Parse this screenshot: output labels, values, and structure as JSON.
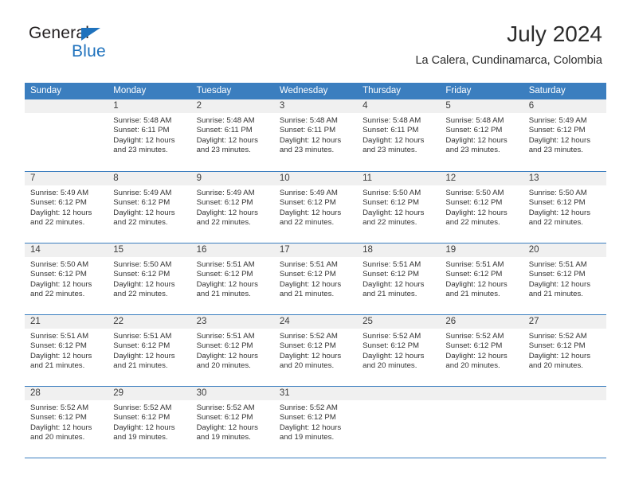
{
  "brand": {
    "name_primary": "General",
    "name_secondary": "Blue",
    "triangle_icon": "triangle-icon",
    "accent_color": "#1f72bd"
  },
  "header": {
    "title": "July 2024",
    "subtitle": "La Calera, Cundinamarca, Colombia"
  },
  "calendar": {
    "header_bg": "#3b7ebf",
    "daynum_bg": "#f0f0f0",
    "weekdays": [
      "Sunday",
      "Monday",
      "Tuesday",
      "Wednesday",
      "Thursday",
      "Friday",
      "Saturday"
    ],
    "weeks": [
      [
        {
          "day": "",
          "empty": true,
          "sunrise": "",
          "sunset": "",
          "daylight1": "",
          "daylight2": ""
        },
        {
          "day": "1",
          "empty": false,
          "sunrise": "Sunrise: 5:48 AM",
          "sunset": "Sunset: 6:11 PM",
          "daylight1": "Daylight: 12 hours",
          "daylight2": "and 23 minutes."
        },
        {
          "day": "2",
          "empty": false,
          "sunrise": "Sunrise: 5:48 AM",
          "sunset": "Sunset: 6:11 PM",
          "daylight1": "Daylight: 12 hours",
          "daylight2": "and 23 minutes."
        },
        {
          "day": "3",
          "empty": false,
          "sunrise": "Sunrise: 5:48 AM",
          "sunset": "Sunset: 6:11 PM",
          "daylight1": "Daylight: 12 hours",
          "daylight2": "and 23 minutes."
        },
        {
          "day": "4",
          "empty": false,
          "sunrise": "Sunrise: 5:48 AM",
          "sunset": "Sunset: 6:11 PM",
          "daylight1": "Daylight: 12 hours",
          "daylight2": "and 23 minutes."
        },
        {
          "day": "5",
          "empty": false,
          "sunrise": "Sunrise: 5:48 AM",
          "sunset": "Sunset: 6:12 PM",
          "daylight1": "Daylight: 12 hours",
          "daylight2": "and 23 minutes."
        },
        {
          "day": "6",
          "empty": false,
          "sunrise": "Sunrise: 5:49 AM",
          "sunset": "Sunset: 6:12 PM",
          "daylight1": "Daylight: 12 hours",
          "daylight2": "and 23 minutes."
        }
      ],
      [
        {
          "day": "7",
          "empty": false,
          "sunrise": "Sunrise: 5:49 AM",
          "sunset": "Sunset: 6:12 PM",
          "daylight1": "Daylight: 12 hours",
          "daylight2": "and 22 minutes."
        },
        {
          "day": "8",
          "empty": false,
          "sunrise": "Sunrise: 5:49 AM",
          "sunset": "Sunset: 6:12 PM",
          "daylight1": "Daylight: 12 hours",
          "daylight2": "and 22 minutes."
        },
        {
          "day": "9",
          "empty": false,
          "sunrise": "Sunrise: 5:49 AM",
          "sunset": "Sunset: 6:12 PM",
          "daylight1": "Daylight: 12 hours",
          "daylight2": "and 22 minutes."
        },
        {
          "day": "10",
          "empty": false,
          "sunrise": "Sunrise: 5:49 AM",
          "sunset": "Sunset: 6:12 PM",
          "daylight1": "Daylight: 12 hours",
          "daylight2": "and 22 minutes."
        },
        {
          "day": "11",
          "empty": false,
          "sunrise": "Sunrise: 5:50 AM",
          "sunset": "Sunset: 6:12 PM",
          "daylight1": "Daylight: 12 hours",
          "daylight2": "and 22 minutes."
        },
        {
          "day": "12",
          "empty": false,
          "sunrise": "Sunrise: 5:50 AM",
          "sunset": "Sunset: 6:12 PM",
          "daylight1": "Daylight: 12 hours",
          "daylight2": "and 22 minutes."
        },
        {
          "day": "13",
          "empty": false,
          "sunrise": "Sunrise: 5:50 AM",
          "sunset": "Sunset: 6:12 PM",
          "daylight1": "Daylight: 12 hours",
          "daylight2": "and 22 minutes."
        }
      ],
      [
        {
          "day": "14",
          "empty": false,
          "sunrise": "Sunrise: 5:50 AM",
          "sunset": "Sunset: 6:12 PM",
          "daylight1": "Daylight: 12 hours",
          "daylight2": "and 22 minutes."
        },
        {
          "day": "15",
          "empty": false,
          "sunrise": "Sunrise: 5:50 AM",
          "sunset": "Sunset: 6:12 PM",
          "daylight1": "Daylight: 12 hours",
          "daylight2": "and 22 minutes."
        },
        {
          "day": "16",
          "empty": false,
          "sunrise": "Sunrise: 5:51 AM",
          "sunset": "Sunset: 6:12 PM",
          "daylight1": "Daylight: 12 hours",
          "daylight2": "and 21 minutes."
        },
        {
          "day": "17",
          "empty": false,
          "sunrise": "Sunrise: 5:51 AM",
          "sunset": "Sunset: 6:12 PM",
          "daylight1": "Daylight: 12 hours",
          "daylight2": "and 21 minutes."
        },
        {
          "day": "18",
          "empty": false,
          "sunrise": "Sunrise: 5:51 AM",
          "sunset": "Sunset: 6:12 PM",
          "daylight1": "Daylight: 12 hours",
          "daylight2": "and 21 minutes."
        },
        {
          "day": "19",
          "empty": false,
          "sunrise": "Sunrise: 5:51 AM",
          "sunset": "Sunset: 6:12 PM",
          "daylight1": "Daylight: 12 hours",
          "daylight2": "and 21 minutes."
        },
        {
          "day": "20",
          "empty": false,
          "sunrise": "Sunrise: 5:51 AM",
          "sunset": "Sunset: 6:12 PM",
          "daylight1": "Daylight: 12 hours",
          "daylight2": "and 21 minutes."
        }
      ],
      [
        {
          "day": "21",
          "empty": false,
          "sunrise": "Sunrise: 5:51 AM",
          "sunset": "Sunset: 6:12 PM",
          "daylight1": "Daylight: 12 hours",
          "daylight2": "and 21 minutes."
        },
        {
          "day": "22",
          "empty": false,
          "sunrise": "Sunrise: 5:51 AM",
          "sunset": "Sunset: 6:12 PM",
          "daylight1": "Daylight: 12 hours",
          "daylight2": "and 21 minutes."
        },
        {
          "day": "23",
          "empty": false,
          "sunrise": "Sunrise: 5:51 AM",
          "sunset": "Sunset: 6:12 PM",
          "daylight1": "Daylight: 12 hours",
          "daylight2": "and 20 minutes."
        },
        {
          "day": "24",
          "empty": false,
          "sunrise": "Sunrise: 5:52 AM",
          "sunset": "Sunset: 6:12 PM",
          "daylight1": "Daylight: 12 hours",
          "daylight2": "and 20 minutes."
        },
        {
          "day": "25",
          "empty": false,
          "sunrise": "Sunrise: 5:52 AM",
          "sunset": "Sunset: 6:12 PM",
          "daylight1": "Daylight: 12 hours",
          "daylight2": "and 20 minutes."
        },
        {
          "day": "26",
          "empty": false,
          "sunrise": "Sunrise: 5:52 AM",
          "sunset": "Sunset: 6:12 PM",
          "daylight1": "Daylight: 12 hours",
          "daylight2": "and 20 minutes."
        },
        {
          "day": "27",
          "empty": false,
          "sunrise": "Sunrise: 5:52 AM",
          "sunset": "Sunset: 6:12 PM",
          "daylight1": "Daylight: 12 hours",
          "daylight2": "and 20 minutes."
        }
      ],
      [
        {
          "day": "28",
          "empty": false,
          "sunrise": "Sunrise: 5:52 AM",
          "sunset": "Sunset: 6:12 PM",
          "daylight1": "Daylight: 12 hours",
          "daylight2": "and 20 minutes."
        },
        {
          "day": "29",
          "empty": false,
          "sunrise": "Sunrise: 5:52 AM",
          "sunset": "Sunset: 6:12 PM",
          "daylight1": "Daylight: 12 hours",
          "daylight2": "and 19 minutes."
        },
        {
          "day": "30",
          "empty": false,
          "sunrise": "Sunrise: 5:52 AM",
          "sunset": "Sunset: 6:12 PM",
          "daylight1": "Daylight: 12 hours",
          "daylight2": "and 19 minutes."
        },
        {
          "day": "31",
          "empty": false,
          "sunrise": "Sunrise: 5:52 AM",
          "sunset": "Sunset: 6:12 PM",
          "daylight1": "Daylight: 12 hours",
          "daylight2": "and 19 minutes."
        },
        {
          "day": "",
          "empty": true,
          "sunrise": "",
          "sunset": "",
          "daylight1": "",
          "daylight2": ""
        },
        {
          "day": "",
          "empty": true,
          "sunrise": "",
          "sunset": "",
          "daylight1": "",
          "daylight2": ""
        },
        {
          "day": "",
          "empty": true,
          "sunrise": "",
          "sunset": "",
          "daylight1": "",
          "daylight2": ""
        }
      ]
    ]
  }
}
